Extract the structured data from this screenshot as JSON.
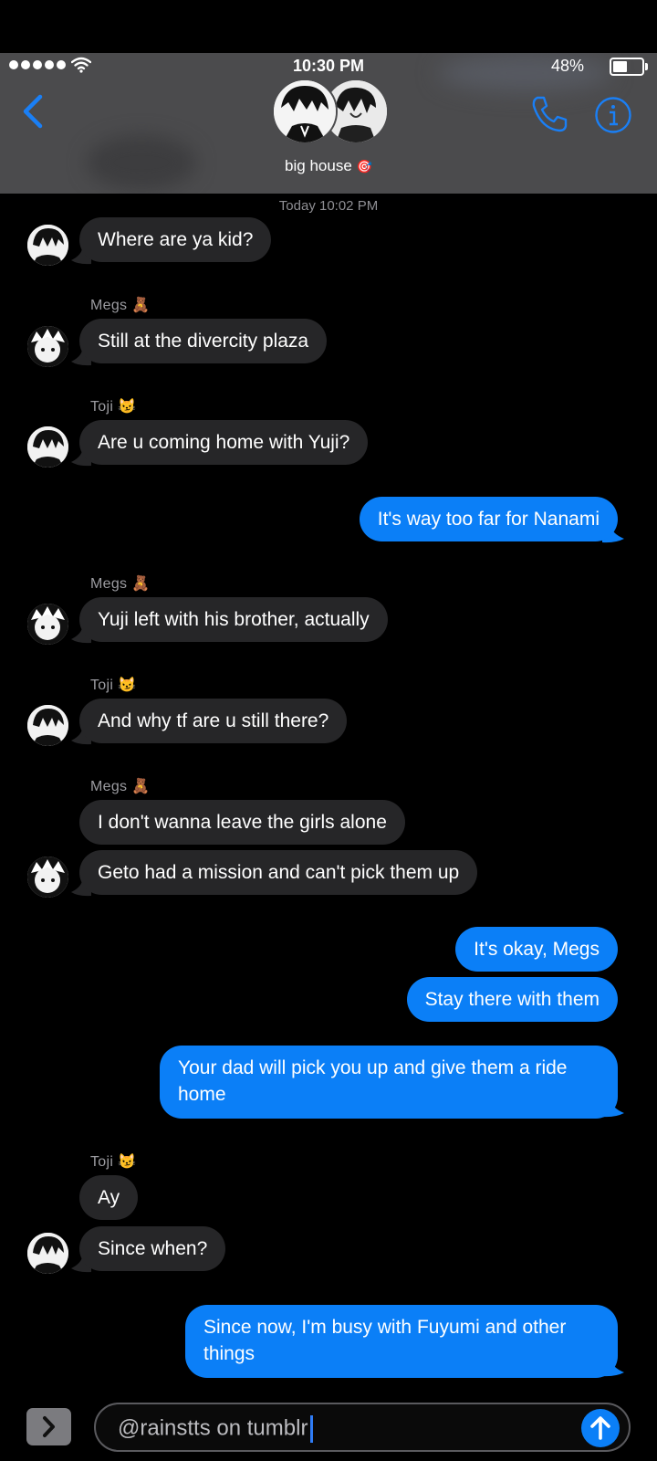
{
  "status_bar": {
    "time": "10:30 PM",
    "battery": "48%",
    "battery_level": 0.48
  },
  "header": {
    "group_name": "big house",
    "group_emoji": "🎯"
  },
  "timestamp": "Today 10:02 PM",
  "messages": [
    {
      "text": "Where are ya kid?"
    },
    {
      "sender": "Megs 🧸",
      "text": "Still at the divercity plaza"
    },
    {
      "sender": "Toji 😼",
      "text": "Are u coming home with Yuji?"
    },
    {
      "text": "It's way too far for Nanami"
    },
    {
      "sender": "Megs 🧸",
      "text": "Yuji left with his brother, actually"
    },
    {
      "sender": "Toji 😼",
      "text": "And why tf are u still there?"
    },
    {
      "sender": "Megs 🧸",
      "text": "I don't wanna leave the girls alone"
    },
    {
      "text": "Geto had a mission and can't pick them up"
    },
    {
      "text": "It's okay, Megs"
    },
    {
      "text": "Stay there with them"
    },
    {
      "text": "Your dad will pick you up and give them a ride home"
    },
    {
      "sender": "Toji 😼",
      "text": "Ay"
    },
    {
      "text": "Since when?"
    },
    {
      "text": "Since now, I'm busy with Fuyumi and other things"
    }
  ],
  "composer": {
    "text": "@rainstts on tumblr"
  },
  "icons": [
    "back-chevron-icon",
    "phone-icon",
    "info-icon",
    "wifi-icon",
    "expand-chevron-icon",
    "send-arrow-icon"
  ]
}
